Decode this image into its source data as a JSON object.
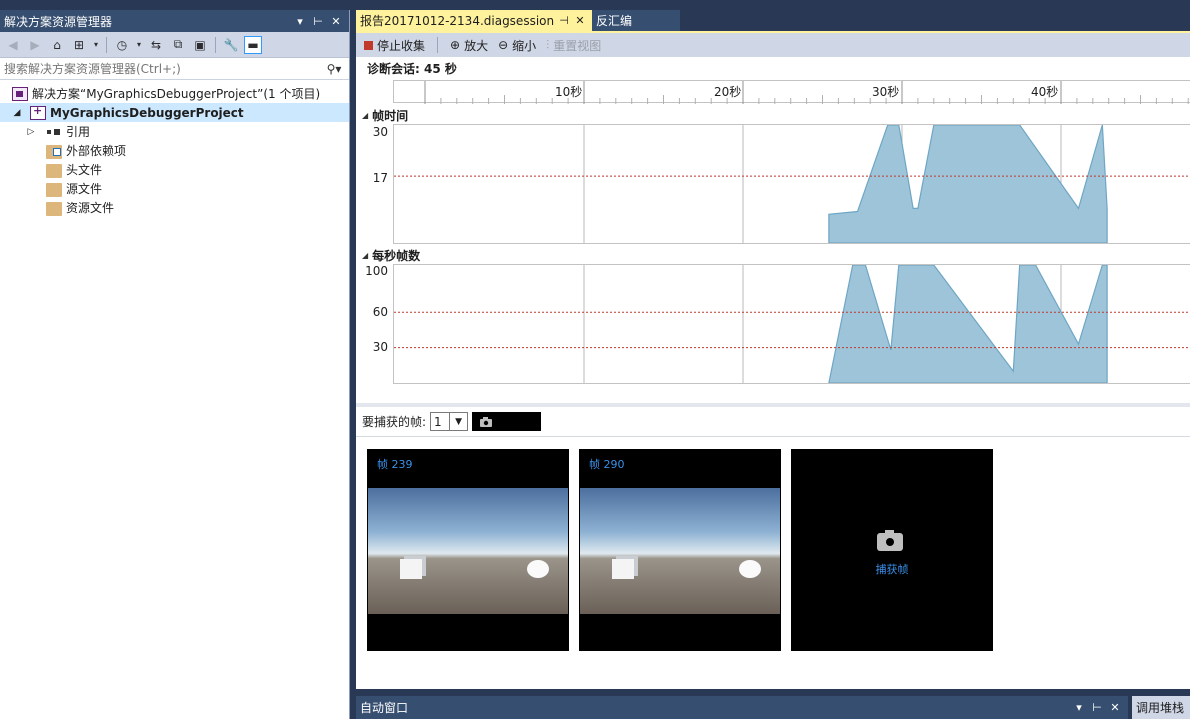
{
  "solution_explorer": {
    "title": "解决方案资源管理器",
    "title_controls": [
      "▾",
      "⊢",
      "✕"
    ],
    "search_placeholder": "搜索解决方案资源管理器(Ctrl+;)",
    "tree": [
      {
        "label": "解决方案“MyGraphicsDebuggerProject”(1 个项目)",
        "indent": 0,
        "icon": "solution-icon",
        "arrow": ""
      },
      {
        "label": "MyGraphicsDebuggerProject",
        "indent": 0,
        "icon": "project-icon",
        "arrow": "◢",
        "selected": true
      },
      {
        "label": "引用",
        "indent": 1,
        "icon": "references-icon",
        "arrow": "▷"
      },
      {
        "label": "外部依赖项",
        "indent": 1,
        "icon": "external-deps-icon",
        "arrow": ""
      },
      {
        "label": "头文件",
        "indent": 1,
        "icon": "folder-icon",
        "arrow": ""
      },
      {
        "label": "源文件",
        "indent": 1,
        "icon": "folder-icon",
        "arrow": ""
      },
      {
        "label": "资源文件",
        "indent": 1,
        "icon": "folder-icon",
        "arrow": ""
      }
    ]
  },
  "tabs": {
    "active_label": "报告20171012-2134.diagsession",
    "inactive_label": "反汇编"
  },
  "diag_toolbar": {
    "stop": "停止收集",
    "zoom_in": "放大",
    "zoom_out": "缩小",
    "reset": "重置视图"
  },
  "session_label": "诊断会话: 45 秒",
  "ruler_labels": [
    "10秒",
    "20秒",
    "30秒",
    "40秒"
  ],
  "frame_time": {
    "title": "帧时间",
    "y_labels": [
      "30",
      "17"
    ]
  },
  "fps": {
    "title": "每秒帧数",
    "y_labels": [
      "100",
      "60",
      "30"
    ]
  },
  "chart_data": [
    {
      "type": "area",
      "title": "帧时间",
      "xlabel": "秒",
      "ylabel": "",
      "xlim": [
        0,
        50
      ],
      "ylim": [
        0,
        30
      ],
      "threshold": 17,
      "x": [
        25.4,
        27.2,
        29.1,
        29.8,
        30.7,
        31.0,
        32.0,
        37.4,
        41.1,
        42.6,
        42.9
      ],
      "values": [
        7.3,
        8.0,
        30,
        30,
        8.8,
        8.8,
        30,
        30,
        8.8,
        30,
        8.8
      ],
      "color": "#9ec4da"
    },
    {
      "type": "area",
      "title": "每秒帧数",
      "xlabel": "秒",
      "ylabel": "",
      "xlim": [
        0,
        50
      ],
      "ylim": [
        0,
        100
      ],
      "thresholds": [
        60,
        30
      ],
      "x": [
        25.4,
        26.9,
        27.7,
        29.3,
        29.8,
        30.7,
        31.0,
        32.0,
        37.0,
        37.4,
        38.4,
        41.1,
        42.6,
        42.9
      ],
      "values": [
        0,
        100,
        100,
        28,
        100,
        100,
        100,
        100,
        10,
        100,
        100,
        33,
        100,
        100
      ],
      "color": "#9ec4da"
    }
  ],
  "capture": {
    "label": "要捕获的帧:",
    "count": "1"
  },
  "frames": [
    {
      "label": "帧 239"
    },
    {
      "label": "帧 290"
    }
  ],
  "capture_tile_label": "捕获帧",
  "auto_window": {
    "title": "自动窗口",
    "controls": [
      "▾",
      "⊢",
      "✕"
    ]
  },
  "call_stack_tab": "调用堆栈"
}
